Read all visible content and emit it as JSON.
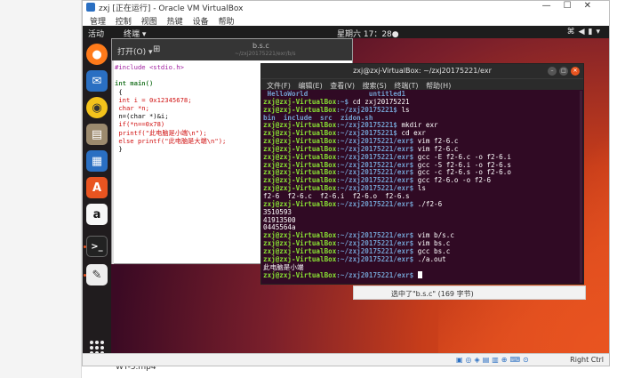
{
  "host": {
    "window_title": "zxj [正在运行] - Oracle VM VirtualBox",
    "menu": [
      "管理",
      "控制",
      "视图",
      "热键",
      "设备",
      "帮助"
    ],
    "bottom_file": "WT-5.mp4",
    "status_right": "Right Ctrl"
  },
  "topbar": {
    "activities": "活动",
    "app_menu": "终端 ▾",
    "clock": "星期六 17：28●"
  },
  "gedit": {
    "open_label": "打开(O) ▾",
    "file_name": "b.s.c",
    "file_path": "~/zxj20175221/exr/b/s",
    "code_lines": [
      "#include <stdio.h>",
      "",
      "int main()",
      " {",
      " int i = 0x12345678;",
      " char *n;",
      " n=(char *)&i;",
      " if(*n==0x78)",
      " printf(\"此电脑是小端\\n\");",
      " else printf(\"此电脑是大端\\n\");",
      " }"
    ],
    "selection_status": "选中了\"b.s.c\" (169 字节)"
  },
  "terminal": {
    "title": "zxj@zxj-VirtualBox: ~/zxj20175221/exr",
    "menu": [
      "文件(F)",
      "编辑(E)",
      "查看(V)",
      "搜索(S)",
      "终端(T)",
      "帮助(H)"
    ],
    "prompt_user": "zxj@zxj-VirtualBox",
    "lines": [
      {
        "kind": "dirlist",
        "items": [
          " HelloWorld",
          "               untitled1"
        ]
      },
      {
        "kind": "cmd",
        "path": ":~$",
        "cmd": " cd zxj20175221"
      },
      {
        "kind": "cmd",
        "path": ":~/zxj20175221$",
        "cmd": " ls"
      },
      {
        "kind": "dirlist",
        "items": [
          "bin  include  src  zidon.sh"
        ]
      },
      {
        "kind": "cmd",
        "path": ":~/zxj20175221$",
        "cmd": " mkdir exr"
      },
      {
        "kind": "cmd",
        "path": ":~/zxj20175221$",
        "cmd": " cd exr"
      },
      {
        "kind": "cmd",
        "path": ":~/zxj20175221/exr$",
        "cmd": " vim f2-6.c"
      },
      {
        "kind": "cmd",
        "path": ":~/zxj20175221/exr$",
        "cmd": " vim f2-6.c"
      },
      {
        "kind": "cmd",
        "path": ":~/zxj20175221/exr$",
        "cmd": " gcc -E f2-6.c -o f2-6.i"
      },
      {
        "kind": "cmd",
        "path": ":~/zxj20175221/exr$",
        "cmd": " gcc -S f2-6.i -o f2-6.s"
      },
      {
        "kind": "cmd",
        "path": ":~/zxj20175221/exr$",
        "cmd": " gcc -c f2-6.s -o f2-6.o"
      },
      {
        "kind": "cmd",
        "path": ":~/zxj20175221/exr$",
        "cmd": " gcc f2-6.o -o f2-6"
      },
      {
        "kind": "cmd",
        "path": ":~/zxj20175221/exr$",
        "cmd": " ls"
      },
      {
        "kind": "ls",
        "plain": "f2-6  f2-6.c  f2-6.i  f2-6.o  f2-6.s"
      },
      {
        "kind": "cmd",
        "path": ":~/zxj20175221/exr$",
        "cmd": " ./f2-6"
      },
      {
        "kind": "out",
        "text": "3510593"
      },
      {
        "kind": "out",
        "text": "41913500"
      },
      {
        "kind": "out",
        "text": "0445564a"
      },
      {
        "kind": "cmd",
        "path": ":~/zxj20175221/exr$",
        "cmd": " vim b/s.c"
      },
      {
        "kind": "cmd",
        "path": ":~/zxj20175221/exr$",
        "cmd": " vim bs.c"
      },
      {
        "kind": "cmd",
        "path": ":~/zxj20175221/exr$",
        "cmd": " gcc bs.c"
      },
      {
        "kind": "cmd",
        "path": ":~/zxj20175221/exr$",
        "cmd": " ./a.out"
      },
      {
        "kind": "out",
        "text": "此电脑是小端"
      },
      {
        "kind": "cmd",
        "path": ":~/zxj20175221/exr$",
        "cmd": " ",
        "cursor": true
      }
    ]
  },
  "dock": {
    "icons": [
      "firefox-icon",
      "thunderbird-icon",
      "rhythmbox-icon",
      "files-icon",
      "writer-icon",
      "software-icon",
      "amazon-icon",
      "terminal-icon",
      "text-editor-icon"
    ],
    "amazon_letter": "a"
  },
  "colors": {
    "terminal_bg": "#300a24",
    "prompt_green": "#8ae234",
    "prompt_blue": "#729fcf",
    "ubuntu_orange": "#e95420"
  }
}
